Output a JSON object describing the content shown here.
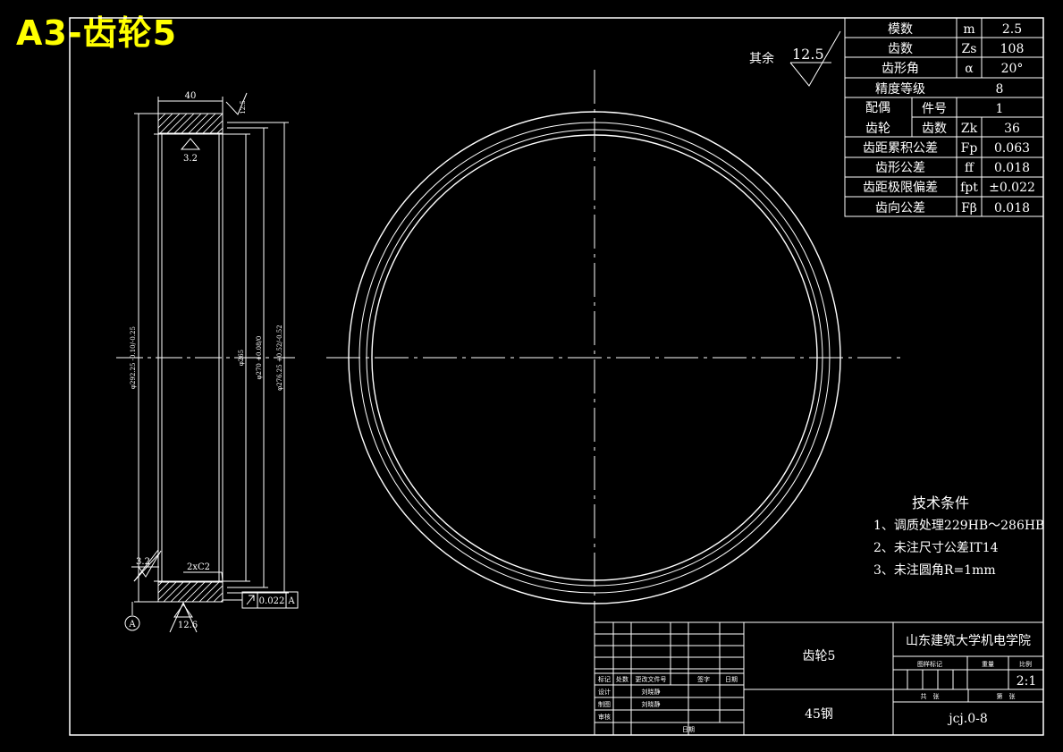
{
  "stamp": "A3-齿轮5",
  "surface_note": {
    "label": "其余",
    "value": "12.5"
  },
  "params": [
    {
      "name": "模数",
      "symbol": "m",
      "value": "2.5"
    },
    {
      "name": "齿数",
      "symbol": "Zs",
      "value": "108"
    },
    {
      "name": "齿形角",
      "symbol": "α",
      "value": "20°"
    },
    {
      "name": "精度等级",
      "symbol": "",
      "value": "8"
    },
    {
      "name": "件号",
      "symbol": "",
      "value": "1"
    },
    {
      "name": "齿数",
      "symbol": "Zk",
      "value": "36"
    },
    {
      "name": "齿距累积公差",
      "symbol": "Fp",
      "value": "0.063"
    },
    {
      "name": "齿形公差",
      "symbol": "ff",
      "value": "0.018"
    },
    {
      "name": "齿距极限偏差",
      "symbol": "fpt",
      "value": "±0.022"
    },
    {
      "name": "齿向公差",
      "symbol": "Fβ",
      "value": "0.018"
    }
  ],
  "mate_label_1": "配偶",
  "mate_label_2": "齿轮",
  "tech": {
    "title": "技术条件",
    "items": [
      "1、调质处理229HB～286HB",
      "2、未注尺寸公差IT14",
      "3、未注圆角R=1mm"
    ]
  },
  "section": {
    "width_dim": "40",
    "rough_top": "12.5",
    "rough_inner": "3.2",
    "rough_corner": "3.2",
    "chamfer": "2xC2",
    "rough_bottom": "12.6",
    "datum": "A",
    "tolerance_value": "0.022",
    "tolerance_datum": "A",
    "dia1": "φ292.25 -0.10/-0.25",
    "dia2": "φ265",
    "dia3": "φ270 +0.08/0",
    "dia4": "φ276.25 +0.52/-0.52"
  },
  "title_block": {
    "part_name": "齿轮5",
    "material": "45钢",
    "school": "山东建筑大学机电学院",
    "scale": "2:1",
    "drawing_no": "jcj.0-8",
    "col_headers": [
      "图样标记",
      "重量",
      "比例"
    ],
    "sheet_labels": [
      "共　张",
      "第　张"
    ],
    "rev_headers": [
      "标记",
      "处数",
      "更改文件号",
      "签字",
      "日期"
    ],
    "roles": [
      "设计",
      "制图",
      "审核"
    ],
    "names": [
      "刘晓静",
      "刘晓静"
    ],
    "date_label": "日期"
  }
}
